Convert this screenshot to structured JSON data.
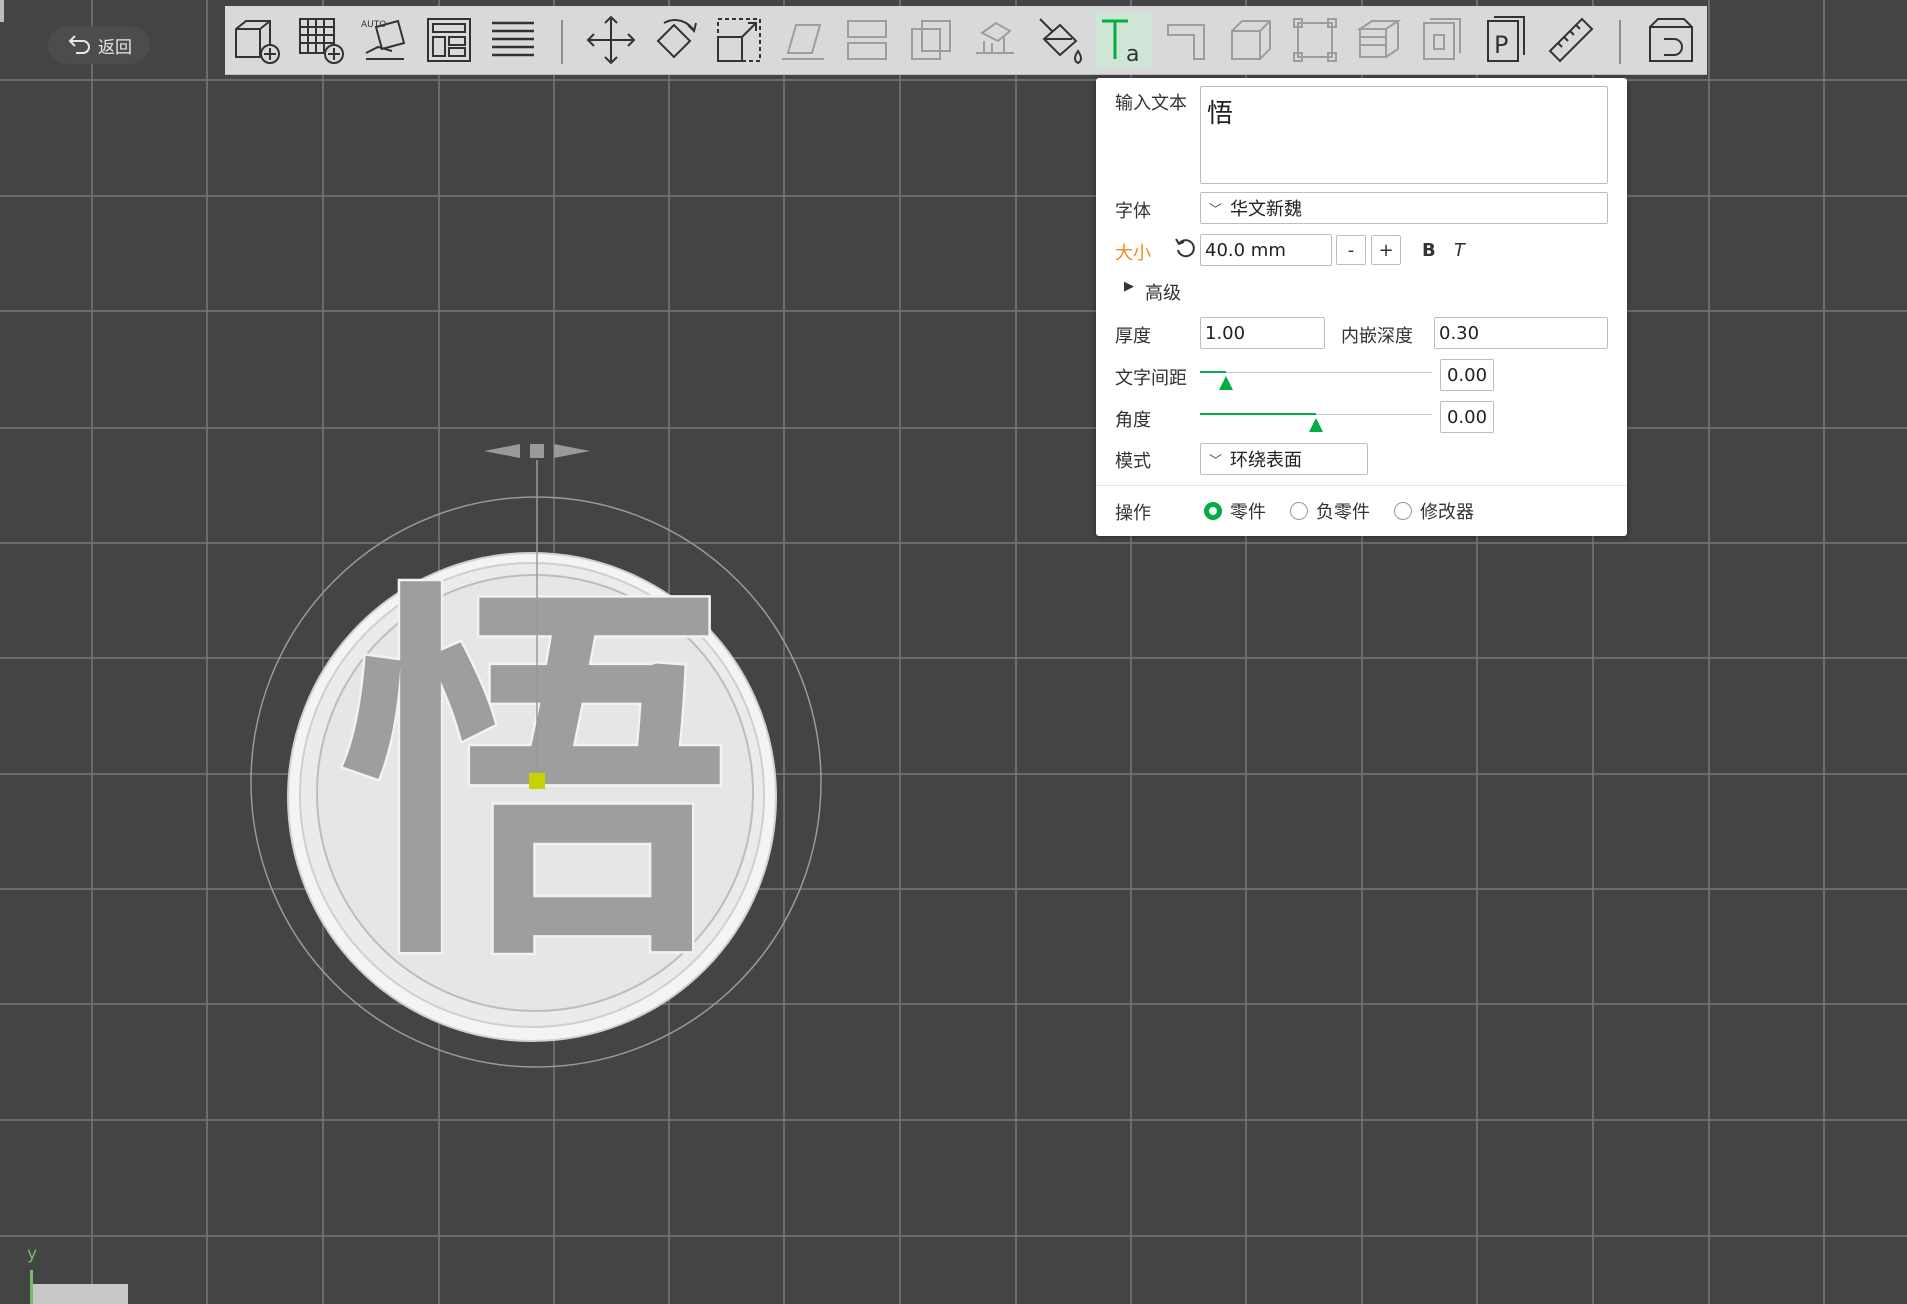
{
  "back_button": {
    "label": "返回"
  },
  "toolbar": {
    "tools": [
      {
        "name": "add-cube-icon"
      },
      {
        "name": "add-plate-icon"
      },
      {
        "name": "auto-orient-icon"
      },
      {
        "name": "arrange-icon"
      },
      {
        "name": "layers-icon"
      },
      {
        "name": "move-icon"
      },
      {
        "name": "rotate-icon"
      },
      {
        "name": "scale-icon"
      },
      {
        "name": "lay-on-face-icon"
      },
      {
        "name": "split-icon"
      },
      {
        "name": "cut-icon"
      },
      {
        "name": "support-icon"
      },
      {
        "name": "paint-icon"
      },
      {
        "name": "text-icon"
      },
      {
        "name": "measure-icon"
      },
      {
        "name": "hollow-icon"
      },
      {
        "name": "assemble-icon"
      },
      {
        "name": "brim-icon"
      },
      {
        "name": "variable-layer-icon"
      },
      {
        "name": "page-icon"
      },
      {
        "name": "ruler-icon"
      },
      {
        "name": "assembly-view-icon"
      }
    ],
    "auto_text": "AUTO"
  },
  "text_panel": {
    "input_label": "输入文本",
    "input_value": "悟",
    "font_label": "字体",
    "font_value": "华文新魏",
    "size_label": "大小",
    "size_value": "40.0 mm",
    "minus": "-",
    "plus": "+",
    "bold": "B",
    "italic": "T",
    "advanced_label": "高级",
    "thickness_label": "厚度",
    "thickness_value": "1.00",
    "embed_depth_label": "内嵌深度",
    "embed_depth_value": "0.30",
    "spacing_label": "文字间距",
    "spacing_value": "0.00",
    "spacing_slider": 0.11,
    "angle_label": "角度",
    "angle_value": "0.00",
    "angle_slider": 0.5,
    "mode_label": "模式",
    "mode_value": "环绕表面",
    "operation_label": "操作",
    "operations": [
      {
        "label": "零件",
        "checked": true
      },
      {
        "label": "负零件",
        "checked": false
      },
      {
        "label": "修改器",
        "checked": false
      }
    ]
  },
  "model": {
    "glyph": "悟"
  },
  "axis": {
    "y_label": "y"
  },
  "colors": {
    "accent": "#00ae42",
    "orange": "#f08a24",
    "background": "#434444"
  }
}
